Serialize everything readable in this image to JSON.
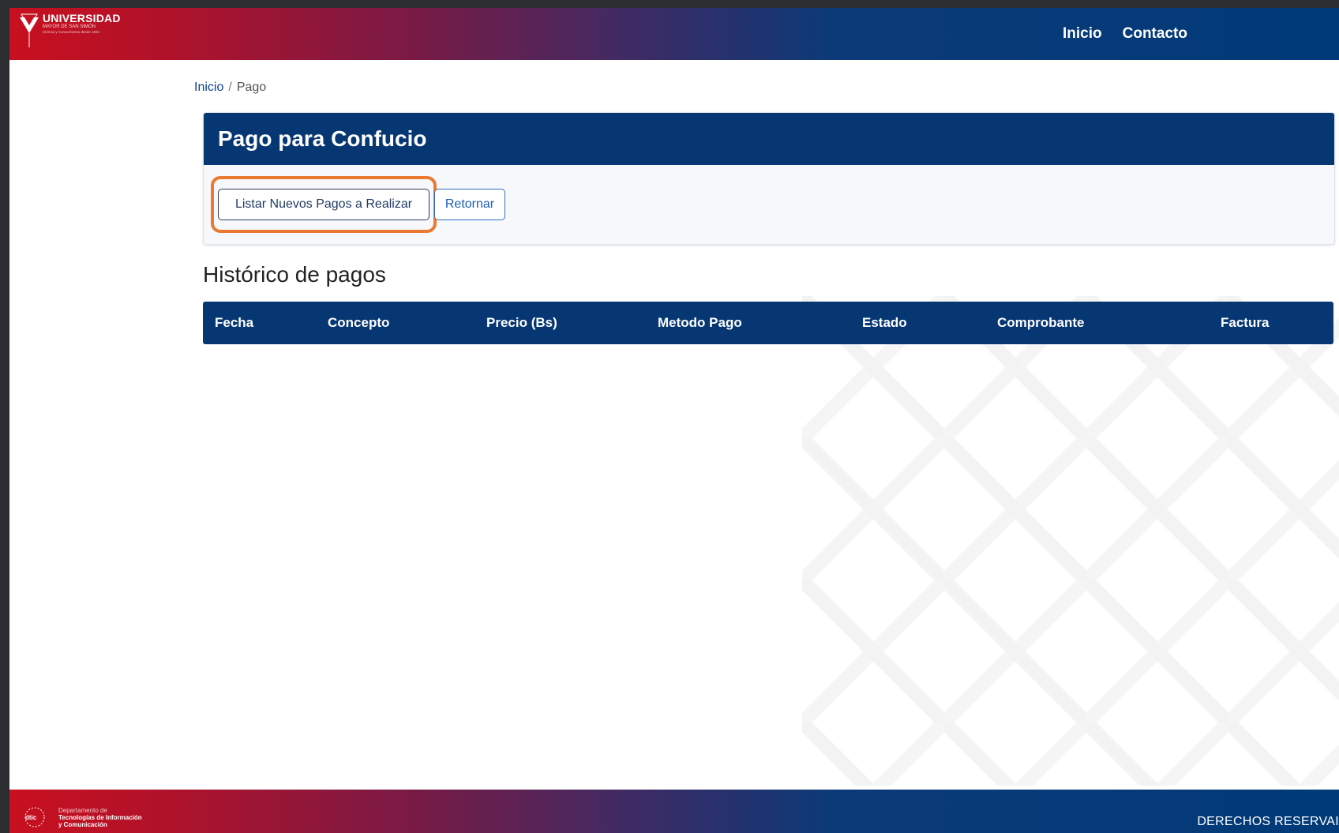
{
  "header": {
    "logo": {
      "title": "UNIVERSIDAD",
      "subtitle": "MAYOR DE SAN SIMÓN",
      "motto": "Ciencia y Conocimiento desde 1832"
    },
    "nav": [
      {
        "label": "Inicio"
      },
      {
        "label": "Contacto"
      }
    ]
  },
  "breadcrumb": {
    "home": "Inicio",
    "separator": "/",
    "current": "Pago"
  },
  "card": {
    "title": "Pago para Confucio",
    "list_button": "Listar Nuevos Pagos a Realizar",
    "return_button": "Retornar"
  },
  "history": {
    "title": "Histórico de pagos",
    "columns": [
      "Fecha",
      "Concepto",
      "Precio (Bs)",
      "Metodo Pago",
      "Estado",
      "Comprobante",
      "Factura"
    ]
  },
  "footer": {
    "dtic": {
      "line1": "Departamento de",
      "line2": "Tecnologías de Información",
      "line3": "y Comunicación"
    },
    "rights": "DERECHOS RESERVAI"
  },
  "colors": {
    "primary": "#063773",
    "brand_red": "#c8101f",
    "highlight": "#ea7a2f"
  }
}
